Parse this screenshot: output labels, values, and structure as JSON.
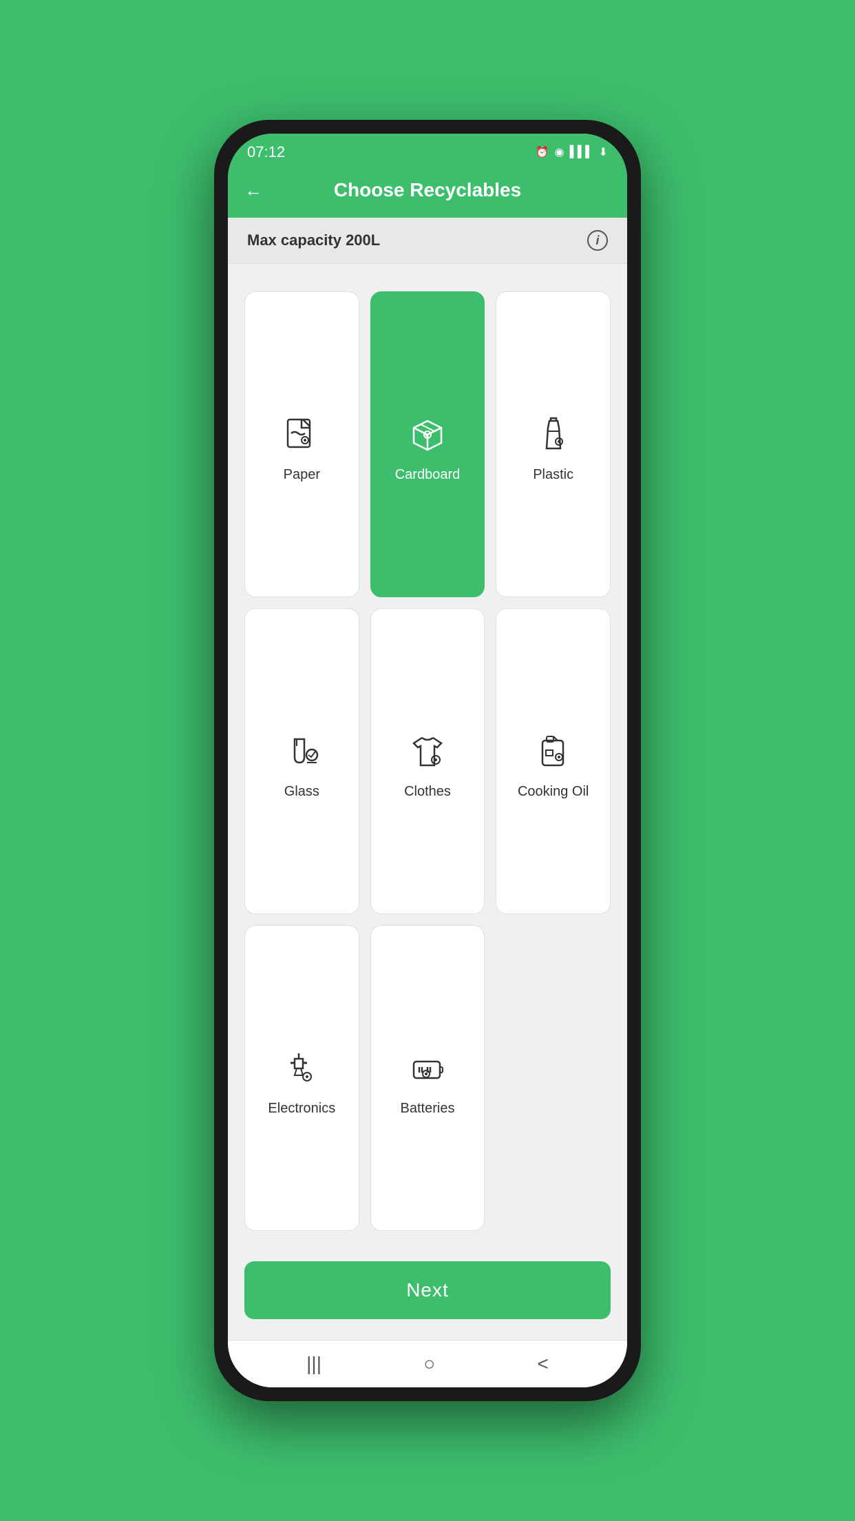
{
  "status": {
    "time": "07:12",
    "icons": "⏰ ◉ ▌▌▌ ⬇"
  },
  "header": {
    "back_label": "←",
    "title": "Choose Recyclables"
  },
  "capacity": {
    "label": "Max capacity 200L",
    "info_label": "i"
  },
  "grid_items": [
    {
      "id": "paper",
      "label": "Paper",
      "selected": false
    },
    {
      "id": "cardboard",
      "label": "Cardboard",
      "selected": true
    },
    {
      "id": "plastic",
      "label": "Plastic",
      "selected": false
    },
    {
      "id": "glass",
      "label": "Glass",
      "selected": false
    },
    {
      "id": "clothes",
      "label": "Clothes",
      "selected": false
    },
    {
      "id": "cooking-oil",
      "label": "Cooking Oil",
      "selected": false
    },
    {
      "id": "electronics",
      "label": "Electronics",
      "selected": false
    },
    {
      "id": "batteries",
      "label": "Batteries",
      "selected": false
    }
  ],
  "next_button": {
    "label": "Next"
  },
  "nav": {
    "items": [
      "|||",
      "○",
      "<"
    ]
  },
  "colors": {
    "green": "#3dbe6c",
    "white": "#ffffff",
    "light_bg": "#f0f0f0",
    "text_dark": "#333333"
  }
}
